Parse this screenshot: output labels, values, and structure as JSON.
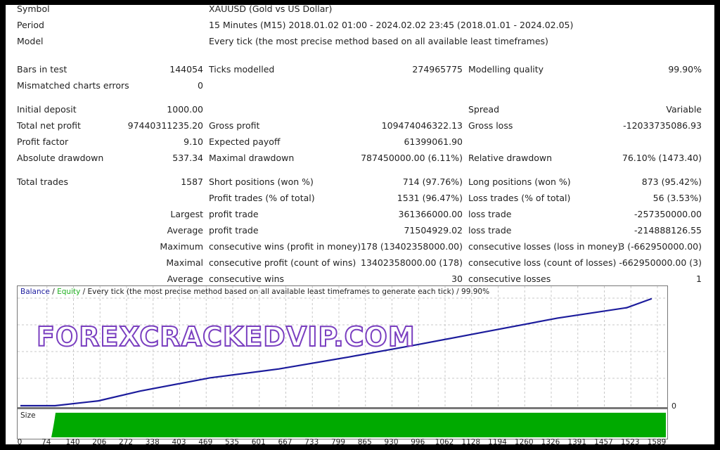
{
  "report": {
    "symbol": {
      "label": "Symbol",
      "value": "XAUUSD (Gold vs US Dollar)"
    },
    "period": {
      "label": "Period",
      "value": "15 Minutes (M15) 2018.01.02 01:00 - 2024.02.02 23:45 (2018.01.01 - 2024.02.05)"
    },
    "model": {
      "label": "Model",
      "value": "Every tick (the most precise method based on all available least timeframes)"
    },
    "rows": [
      [
        "Bars in test",
        "144054",
        "Ticks modelled",
        "274965775",
        "Modelling quality",
        "99.90%"
      ],
      [
        "Mismatched charts errors",
        "0",
        "",
        "",
        "",
        ""
      ],
      [
        "Initial deposit",
        "1000.00",
        "",
        "",
        "Spread",
        "Variable"
      ],
      [
        "Total net profit",
        "97440311235.20",
        "Gross profit",
        "109474046322.13",
        "Gross loss",
        "-12033735086.93"
      ],
      [
        "Profit factor",
        "9.10",
        "Expected payoff",
        "61399061.90",
        "",
        ""
      ],
      [
        "Absolute drawdown",
        "537.34",
        "Maximal drawdown",
        "787450000.00 (6.11%)",
        "Relative drawdown",
        "76.10% (1473.40)"
      ],
      [
        "Total trades",
        "1587",
        "Short positions (won %)",
        "714 (97.76%)",
        "Long positions (won %)",
        "873 (95.42%)"
      ],
      [
        "",
        "",
        "Profit trades (% of total)",
        "1531 (96.47%)",
        "Loss trades (% of total)",
        "56 (3.53%)"
      ],
      [
        "",
        "Largest",
        "profit trade",
        "361366000.00",
        "loss trade",
        "-257350000.00"
      ],
      [
        "",
        "Average",
        "profit trade",
        "71504929.02",
        "loss trade",
        "-214888126.55"
      ],
      [
        "",
        "Maximum",
        "consecutive wins (profit in money)",
        "178 (13402358000.00)",
        "consecutive losses (loss in money)",
        "3 (-662950000.00)"
      ],
      [
        "",
        "Maximal",
        "consecutive profit (count of wins)",
        "13402358000.00 (178)",
        "consecutive loss (count of losses)",
        "-662950000.00 (3)"
      ],
      [
        "",
        "Average",
        "consecutive wins",
        "30",
        "consecutive losses",
        "1"
      ]
    ]
  },
  "chart_data": {
    "type": "line",
    "legend": {
      "balance": "Balance",
      "sep1": " / ",
      "equity": "Equity",
      "rest": " / Every tick (the most precise method based on all available least timeframes to generate each tick) / 99.90%"
    },
    "series": [
      {
        "name": "Balance",
        "color": "#1c1c9c",
        "x": [
          0,
          87,
          196,
          301,
          476,
          650,
          825,
          1000,
          1175,
          1350,
          1524,
          1587
        ],
        "y": [
          1000,
          1000,
          4400000000,
          13300000000,
          25300000000,
          33500000000,
          44300000000,
          55700000000,
          67700000000,
          79700000000,
          89200000000,
          97441311235
        ]
      }
    ],
    "xlim": [
      0,
      1600
    ],
    "ylim": [
      0,
      108800000000
    ],
    "x_ticks": [
      "0",
      "74",
      "140",
      "206",
      "272",
      "338",
      "403",
      "469",
      "535",
      "601",
      "667",
      "733",
      "799",
      "865",
      "930",
      "996",
      "1062",
      "1128",
      "1194",
      "1260",
      "1326",
      "1391",
      "1457",
      "1523",
      "1589"
    ],
    "y_tick_labels": [
      "0"
    ],
    "grid": true,
    "size_pane": {
      "label": "Size",
      "color": "#00aa00"
    }
  },
  "watermark": "FOREXCRACKEDVIP.COM"
}
